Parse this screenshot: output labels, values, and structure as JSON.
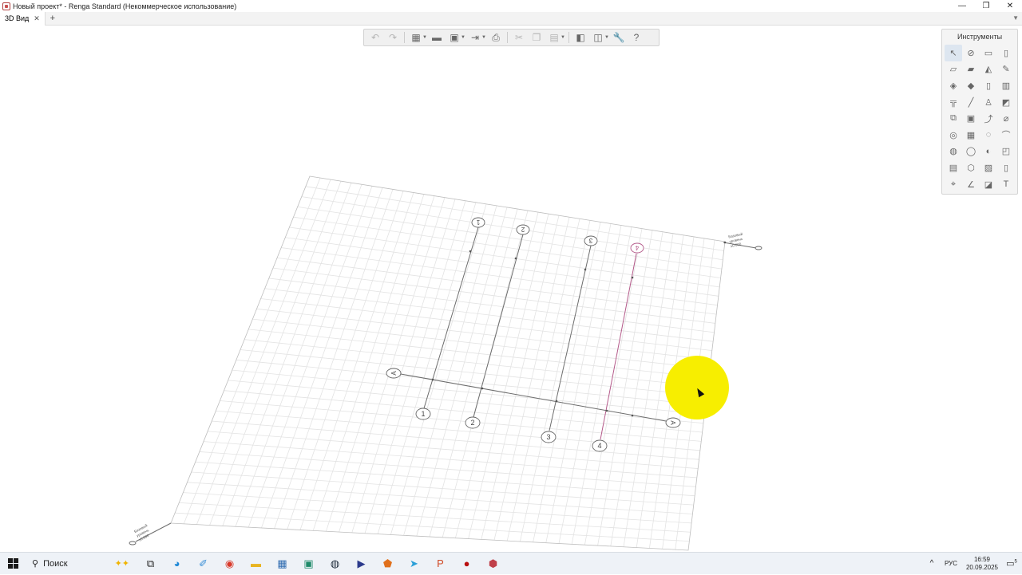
{
  "window": {
    "title": "Новый проект* - Renga Standard (Некоммерческое использование)",
    "controls": [
      "—",
      "❐",
      "✕"
    ]
  },
  "tabs": [
    {
      "label": "3D Вид",
      "close": "✕"
    }
  ],
  "tab_add": "+",
  "tab_menu": "▼",
  "toolbar": {
    "buttons": [
      {
        "name": "undo-icon",
        "glyph": "↶",
        "disabled": true
      },
      {
        "name": "redo-icon",
        "glyph": "↷",
        "disabled": true
      },
      {
        "name": "view-modes-icon",
        "glyph": "▦",
        "disabled": false
      },
      {
        "name": "open-folder-icon",
        "glyph": "▬",
        "disabled": false
      },
      {
        "name": "save-icon",
        "glyph": "▣",
        "disabled": false
      },
      {
        "name": "export-icon",
        "glyph": "⇥",
        "disabled": false
      },
      {
        "name": "print-icon",
        "glyph": "⎙",
        "disabled": false
      },
      {
        "name": "cut-icon",
        "glyph": "✂",
        "disabled": true
      },
      {
        "name": "copy-icon",
        "glyph": "❐",
        "disabled": true
      },
      {
        "name": "paste-icon",
        "glyph": "▤",
        "disabled": true
      },
      {
        "name": "properties-icon",
        "glyph": "◧",
        "disabled": false
      },
      {
        "name": "layers-icon",
        "glyph": "◫",
        "disabled": false
      },
      {
        "name": "settings-wrench-icon",
        "glyph": "🔧",
        "disabled": false
      },
      {
        "name": "help-icon",
        "glyph": "?",
        "disabled": false
      }
    ]
  },
  "tools_panel": {
    "title": "Инструменты",
    "items": [
      {
        "name": "select-tool-icon",
        "glyph": "↖"
      },
      {
        "name": "axis-tool-icon",
        "glyph": "⊘"
      },
      {
        "name": "wall-tool-icon",
        "glyph": "▭"
      },
      {
        "name": "column-tool-icon",
        "glyph": "▯"
      },
      {
        "name": "beam-tool-icon",
        "glyph": "▱"
      },
      {
        "name": "slab-tool-icon",
        "glyph": "▰"
      },
      {
        "name": "roof-tool-icon",
        "glyph": "◭"
      },
      {
        "name": "ruler-tool-icon",
        "glyph": "✎"
      },
      {
        "name": "floor-tool-icon",
        "glyph": "◈"
      },
      {
        "name": "plate-tool-icon",
        "glyph": "◆"
      },
      {
        "name": "door-tool-icon",
        "glyph": "▯"
      },
      {
        "name": "window-tool-icon",
        "glyph": "▥"
      },
      {
        "name": "railing-tool-icon",
        "glyph": "╦"
      },
      {
        "name": "line-tool-icon",
        "glyph": "╱"
      },
      {
        "name": "equipment-tool-icon",
        "glyph": "♙"
      },
      {
        "name": "opening-tool-icon",
        "glyph": "◩"
      },
      {
        "name": "stair-tool-icon",
        "glyph": "⧉"
      },
      {
        "name": "room-tool-icon",
        "glyph": "▣"
      },
      {
        "name": "ramp-tool-icon",
        "glyph": "⤴"
      },
      {
        "name": "pipe-tool-icon",
        "glyph": "⌀"
      },
      {
        "name": "fitting-tool-icon",
        "glyph": "◎"
      },
      {
        "name": "area-tool-icon",
        "glyph": "▦"
      },
      {
        "name": "element-tool-icon",
        "glyph": "◌"
      },
      {
        "name": "duct-tool-icon",
        "glyph": "⌒"
      },
      {
        "name": "cable-tool-icon",
        "glyph": "◍"
      },
      {
        "name": "hole-tool-icon",
        "glyph": "◯"
      },
      {
        "name": "pump-tool-icon",
        "glyph": "◐"
      },
      {
        "name": "box-tool-icon",
        "glyph": "◰"
      },
      {
        "name": "cabinet-tool-icon",
        "glyph": "▤"
      },
      {
        "name": "shape-tool-icon",
        "glyph": "⬡"
      },
      {
        "name": "group-tool-icon",
        "glyph": "▨"
      },
      {
        "name": "panel-tool-icon",
        "glyph": "▯"
      },
      {
        "name": "dimension-tool-icon",
        "glyph": "⌖"
      },
      {
        "name": "angle-tool-icon",
        "glyph": "∠"
      },
      {
        "name": "hatch-tool-icon",
        "glyph": "◪"
      },
      {
        "name": "text-tool-icon",
        "glyph": "T"
      }
    ]
  },
  "scene": {
    "level_label_top": [
      "Базовый",
      "уровень",
      "±0.000"
    ],
    "level_label_bottom": [
      "Базовый",
      "уровень",
      "±0.000"
    ],
    "axis_labels_front": [
      "1",
      "2",
      "3",
      "4"
    ],
    "axis_labels_back": [
      "1",
      "2",
      "3",
      "4"
    ],
    "axis_label_cross_left": "А",
    "axis_label_cross_right": "А"
  },
  "taskbar": {
    "search_label": "Поиск",
    "apps": [
      {
        "name": "task-view-icon",
        "glyph": "⧉",
        "color": "#222222"
      },
      {
        "name": "edge-browser-icon",
        "glyph": "◕",
        "color": "#1e88d6"
      },
      {
        "name": "paint-icon",
        "glyph": "✐",
        "color": "#3a8fd6"
      },
      {
        "name": "chrome-browser-icon",
        "glyph": "◉",
        "color": "#d93a2b"
      },
      {
        "name": "file-explorer-icon",
        "glyph": "▬",
        "color": "#e8b422"
      },
      {
        "name": "calculator-icon",
        "glyph": "▦",
        "color": "#2e6bb0"
      },
      {
        "name": "screen-app-icon",
        "glyph": "▣",
        "color": "#1f8a6a"
      },
      {
        "name": "steam-icon",
        "glyph": "◍",
        "color": "#1b2838"
      },
      {
        "name": "media-player-icon",
        "glyph": "▶",
        "color": "#2b3a8c"
      },
      {
        "name": "shield-app-icon",
        "glyph": "⬟",
        "color": "#e0701c"
      },
      {
        "name": "telegram-icon",
        "glyph": "➤",
        "color": "#2a9fd8"
      },
      {
        "name": "powerpoint-icon",
        "glyph": "P",
        "color": "#d04b27"
      },
      {
        "name": "obs-record-icon",
        "glyph": "●",
        "color": "#b91010"
      },
      {
        "name": "renga-app-icon",
        "glyph": "⬢",
        "color": "#c0404a"
      }
    ],
    "tray_chevron": "^",
    "language": "РУС",
    "time": "16:59",
    "date": "20.09.2025",
    "notifications_count": "5"
  }
}
